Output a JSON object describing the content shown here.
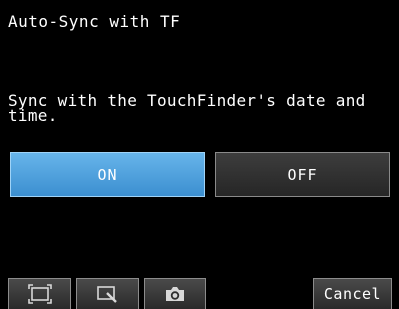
{
  "header": {
    "title": "Auto-Sync with TF"
  },
  "message": "Sync with the TouchFinder's date and time.",
  "options": {
    "on_label": "ON",
    "off_label": "OFF"
  },
  "toolbar": {
    "icons": [
      "fit-screen-icon",
      "zoom-icon",
      "camera-icon"
    ],
    "cancel_label": "Cancel"
  },
  "colors": {
    "background": "#000000",
    "selected_button": "#4ea2df",
    "unselected_button": "#303030",
    "text": "#ffffff"
  }
}
